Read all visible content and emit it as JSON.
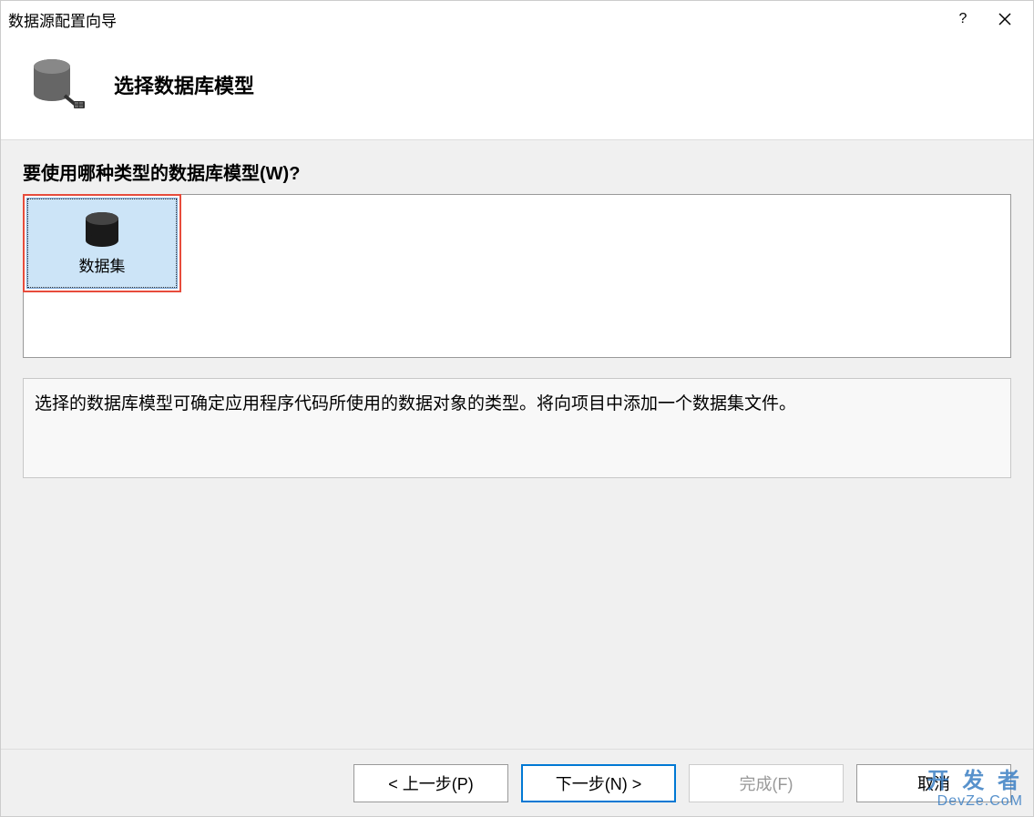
{
  "titlebar": {
    "title": "数据源配置向导",
    "help_label": "?",
    "close_label": "×"
  },
  "header": {
    "title": "选择数据库模型"
  },
  "content": {
    "prompt": "要使用哪种类型的数据库模型(W)?",
    "options": {
      "dataset_label": "数据集"
    },
    "description": "选择的数据库模型可确定应用程序代码所使用的数据对象的类型。将向项目中添加一个数据集文件。"
  },
  "buttons": {
    "previous": "< 上一步(P)",
    "next": "下一步(N) >",
    "finish": "完成(F)",
    "cancel": "取消"
  },
  "watermark": {
    "line1": "开 发 者",
    "line2": "DevZe.CoM"
  }
}
